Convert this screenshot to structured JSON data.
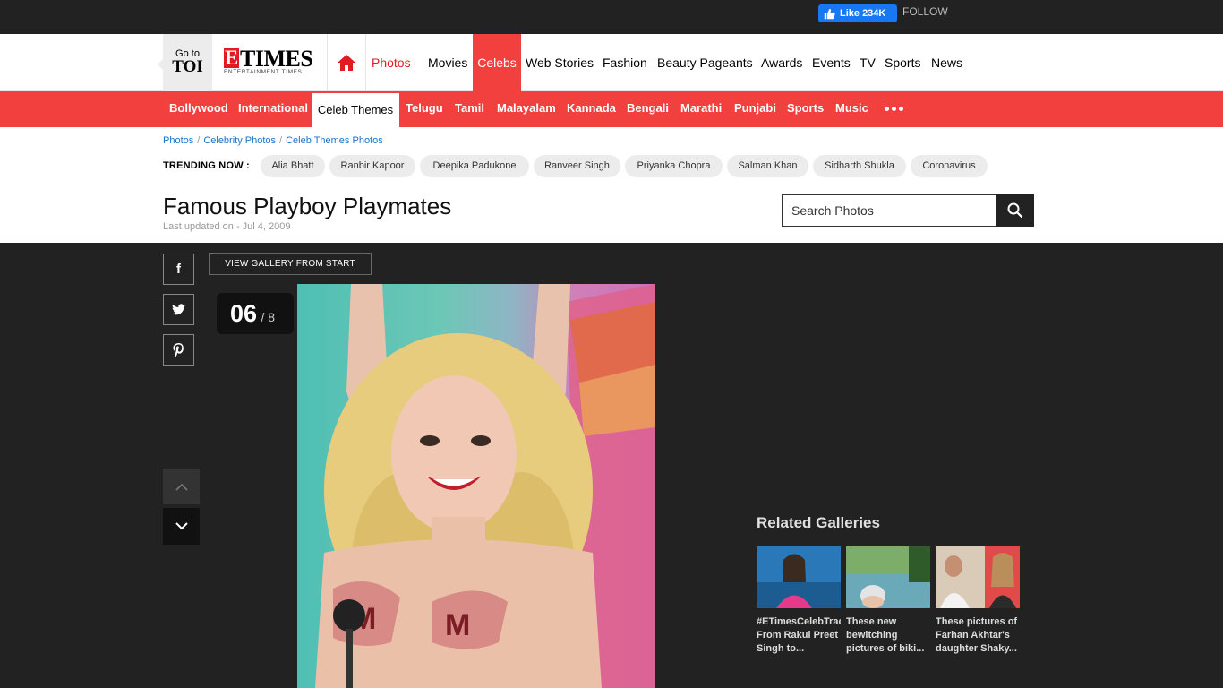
{
  "topbar": {
    "like_label": "Like 234K",
    "follow_label": "FOLLOW"
  },
  "nav": {
    "goto_line1": "Go to",
    "goto_line2": "TOI",
    "logo_letter": "E",
    "logo_word": "TIMES",
    "logo_sub": "ENTERTAINMENT TIMES",
    "items": [
      "Photos",
      "Movies",
      "Celebs",
      "Web Stories",
      "Fashion",
      "Beauty Pageants",
      "Awards",
      "Events",
      "TV",
      "Sports",
      "News"
    ]
  },
  "subnav": {
    "items": [
      "Bollywood",
      "International",
      "Celeb Themes",
      "Telugu",
      "Tamil",
      "Malayalam",
      "Kannada",
      "Bengali",
      "Marathi",
      "Punjabi",
      "Sports",
      "Music"
    ]
  },
  "breadcrumb": [
    "Photos",
    "Celebrity Photos",
    "Celeb Themes Photos"
  ],
  "trending": {
    "label": "TRENDING NOW :",
    "items": [
      "Alia Bhatt",
      "Ranbir Kapoor",
      "Deepika Padukone",
      "Ranveer Singh",
      "Priyanka Chopra",
      "Salman Khan",
      "Sidharth Shukla",
      "Coronavirus"
    ]
  },
  "page": {
    "title": "Famous Playboy Playmates",
    "updated": "Last updated on - Jul 4, 2009"
  },
  "search": {
    "placeholder": "Search Photos"
  },
  "gallery": {
    "view_start_label": "VIEW GALLERY FROM START",
    "current": "06",
    "total": "/ 8",
    "share": [
      "f",
      "t",
      "p"
    ]
  },
  "related": {
    "title": "Related Galleries",
    "items": [
      {
        "caption": "#ETimesCelebTracker: From Rakul Preet Singh to..."
      },
      {
        "caption": "These new bewitching pictures of biki..."
      },
      {
        "caption": "These pictures of Farhan Akhtar's daughter Shaky..."
      }
    ]
  },
  "colors": {
    "brand_red": "#f2403f",
    "dark_bg": "#222222",
    "link_blue": "#1a73c8"
  }
}
